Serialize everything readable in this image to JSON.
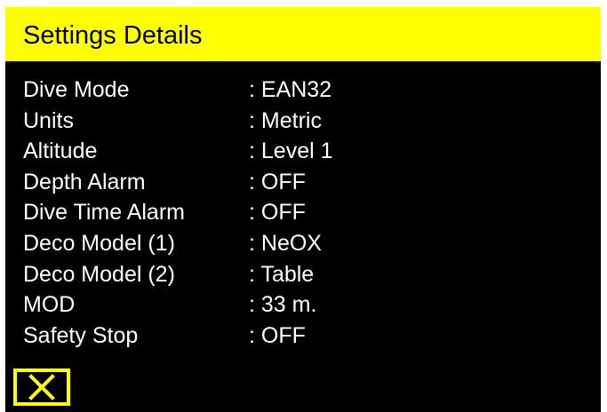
{
  "header": {
    "title": "Settings Details"
  },
  "settings": [
    {
      "label": "Dive Mode",
      "value": ": EAN32"
    },
    {
      "label": "Units",
      "value": ": Metric"
    },
    {
      "label": "Altitude",
      "value": ": Level 1"
    },
    {
      "label": "Depth Alarm",
      "value": ": OFF"
    },
    {
      "label": "Dive Time Alarm",
      "value": ": OFF"
    },
    {
      "label": "Deco Model (1)",
      "value": ": NeOX"
    },
    {
      "label": "Deco Model (2)",
      "value": ": Table"
    },
    {
      "label": "MOD",
      "value": ": 33 m."
    },
    {
      "label": "Safety Stop",
      "value": ": OFF"
    }
  ],
  "close_button": {
    "icon": "close-icon"
  },
  "colors": {
    "accent": "#ffff00",
    "background": "#000000",
    "text": "#ffffff"
  }
}
